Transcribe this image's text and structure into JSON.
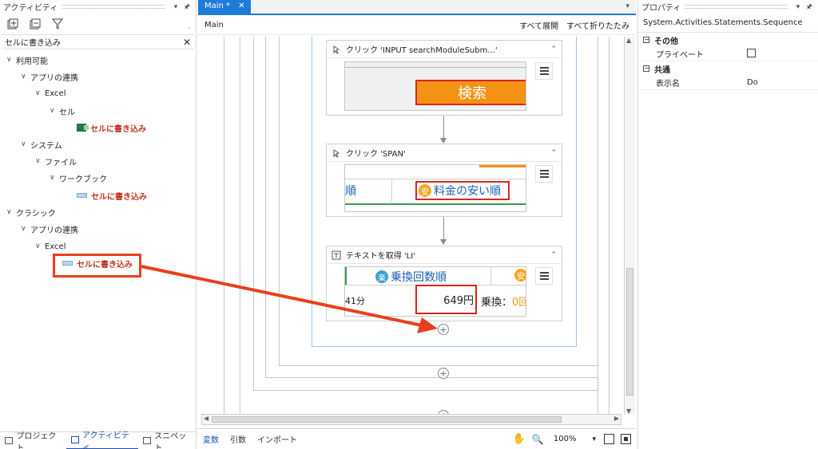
{
  "activities_panel": {
    "title": "アクティビティ",
    "search_value": "セルに書き込み",
    "tree": [
      {
        "label": "利用可能",
        "type": "folder"
      },
      {
        "label": "アプリの連携",
        "type": "folder"
      },
      {
        "label": "Excel",
        "type": "folder"
      },
      {
        "label": "セル",
        "type": "folder"
      },
      {
        "label": "セルに書き込み",
        "type": "activity"
      },
      {
        "label": "システム",
        "type": "folder"
      },
      {
        "label": "ファイル",
        "type": "folder"
      },
      {
        "label": "ワークブック",
        "type": "folder"
      },
      {
        "label": "セルに書き込み",
        "type": "activity"
      },
      {
        "label": "クラシック",
        "type": "folder"
      },
      {
        "label": "アプリの連携",
        "type": "folder"
      },
      {
        "label": "Excel",
        "type": "folder"
      },
      {
        "label": "セルに書き込み",
        "type": "activity"
      }
    ],
    "bottom_tabs": [
      {
        "label": "プロジェクト"
      },
      {
        "label": "アクティビティ"
      },
      {
        "label": "スニペット"
      }
    ]
  },
  "designer": {
    "tab_label": "Main *",
    "breadcrumb": "Main",
    "expand_all": "すべて展開",
    "collapse_all": "すべて折りたたみ",
    "activities": [
      {
        "title": "クリック 'INPUT  searchModuleSubm...'",
        "screenshot_text": "検索"
      },
      {
        "title": "クリック 'SPAN'",
        "screenshot_text_left": "順",
        "screenshot_badge": "安",
        "screenshot_text": "料金の安い順"
      },
      {
        "title": "テキストを取得 'LI'",
        "screenshot_badge": "楽",
        "screenshot_header": "乗換回数順",
        "screenshot_badge2": "安",
        "screenshot_left": "41分",
        "screenshot_value": "649円",
        "screenshot_right": "乗換：",
        "screenshot_right_num": "0回"
      }
    ]
  },
  "statusbar": {
    "variables": "変数",
    "arguments": "引数",
    "imports": "インポート",
    "zoom": "100%"
  },
  "properties_panel": {
    "title": "プロパティ",
    "type_name": "System.Activities.Statements.Sequence",
    "categories": [
      {
        "name": "その他",
        "rows": [
          {
            "key": "プライベート",
            "value": ""
          }
        ]
      },
      {
        "name": "共通",
        "rows": [
          {
            "key": "表示名",
            "value": "Do"
          }
        ]
      }
    ]
  },
  "colors": {
    "accent": "#1e7bd8",
    "annotation": "#e8401c",
    "search_button": "#f39214",
    "activity_text": "#c0321e"
  }
}
